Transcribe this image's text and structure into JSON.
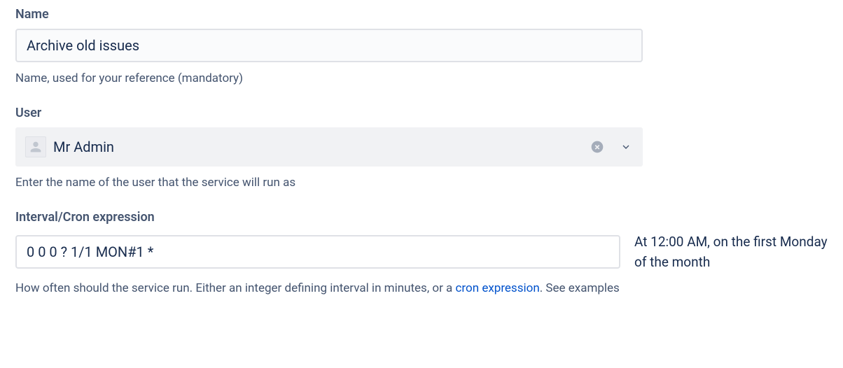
{
  "name_field": {
    "label": "Name",
    "value": "Archive old issues",
    "help": "Name, used for your reference (mandatory)"
  },
  "user_field": {
    "label": "User",
    "value": "Mr Admin",
    "help": "Enter the name of the user that the service will run as"
  },
  "cron_field": {
    "label": "Interval/Cron expression",
    "value": "0 0 0 ? 1/1 MON#1 *",
    "description": "At 12:00 AM, on the first Monday of the month",
    "help_prefix": "How often should the service run. Either an integer defining interval in minutes, or a ",
    "help_link_text": "cron expression",
    "help_suffix": ". See examples"
  }
}
